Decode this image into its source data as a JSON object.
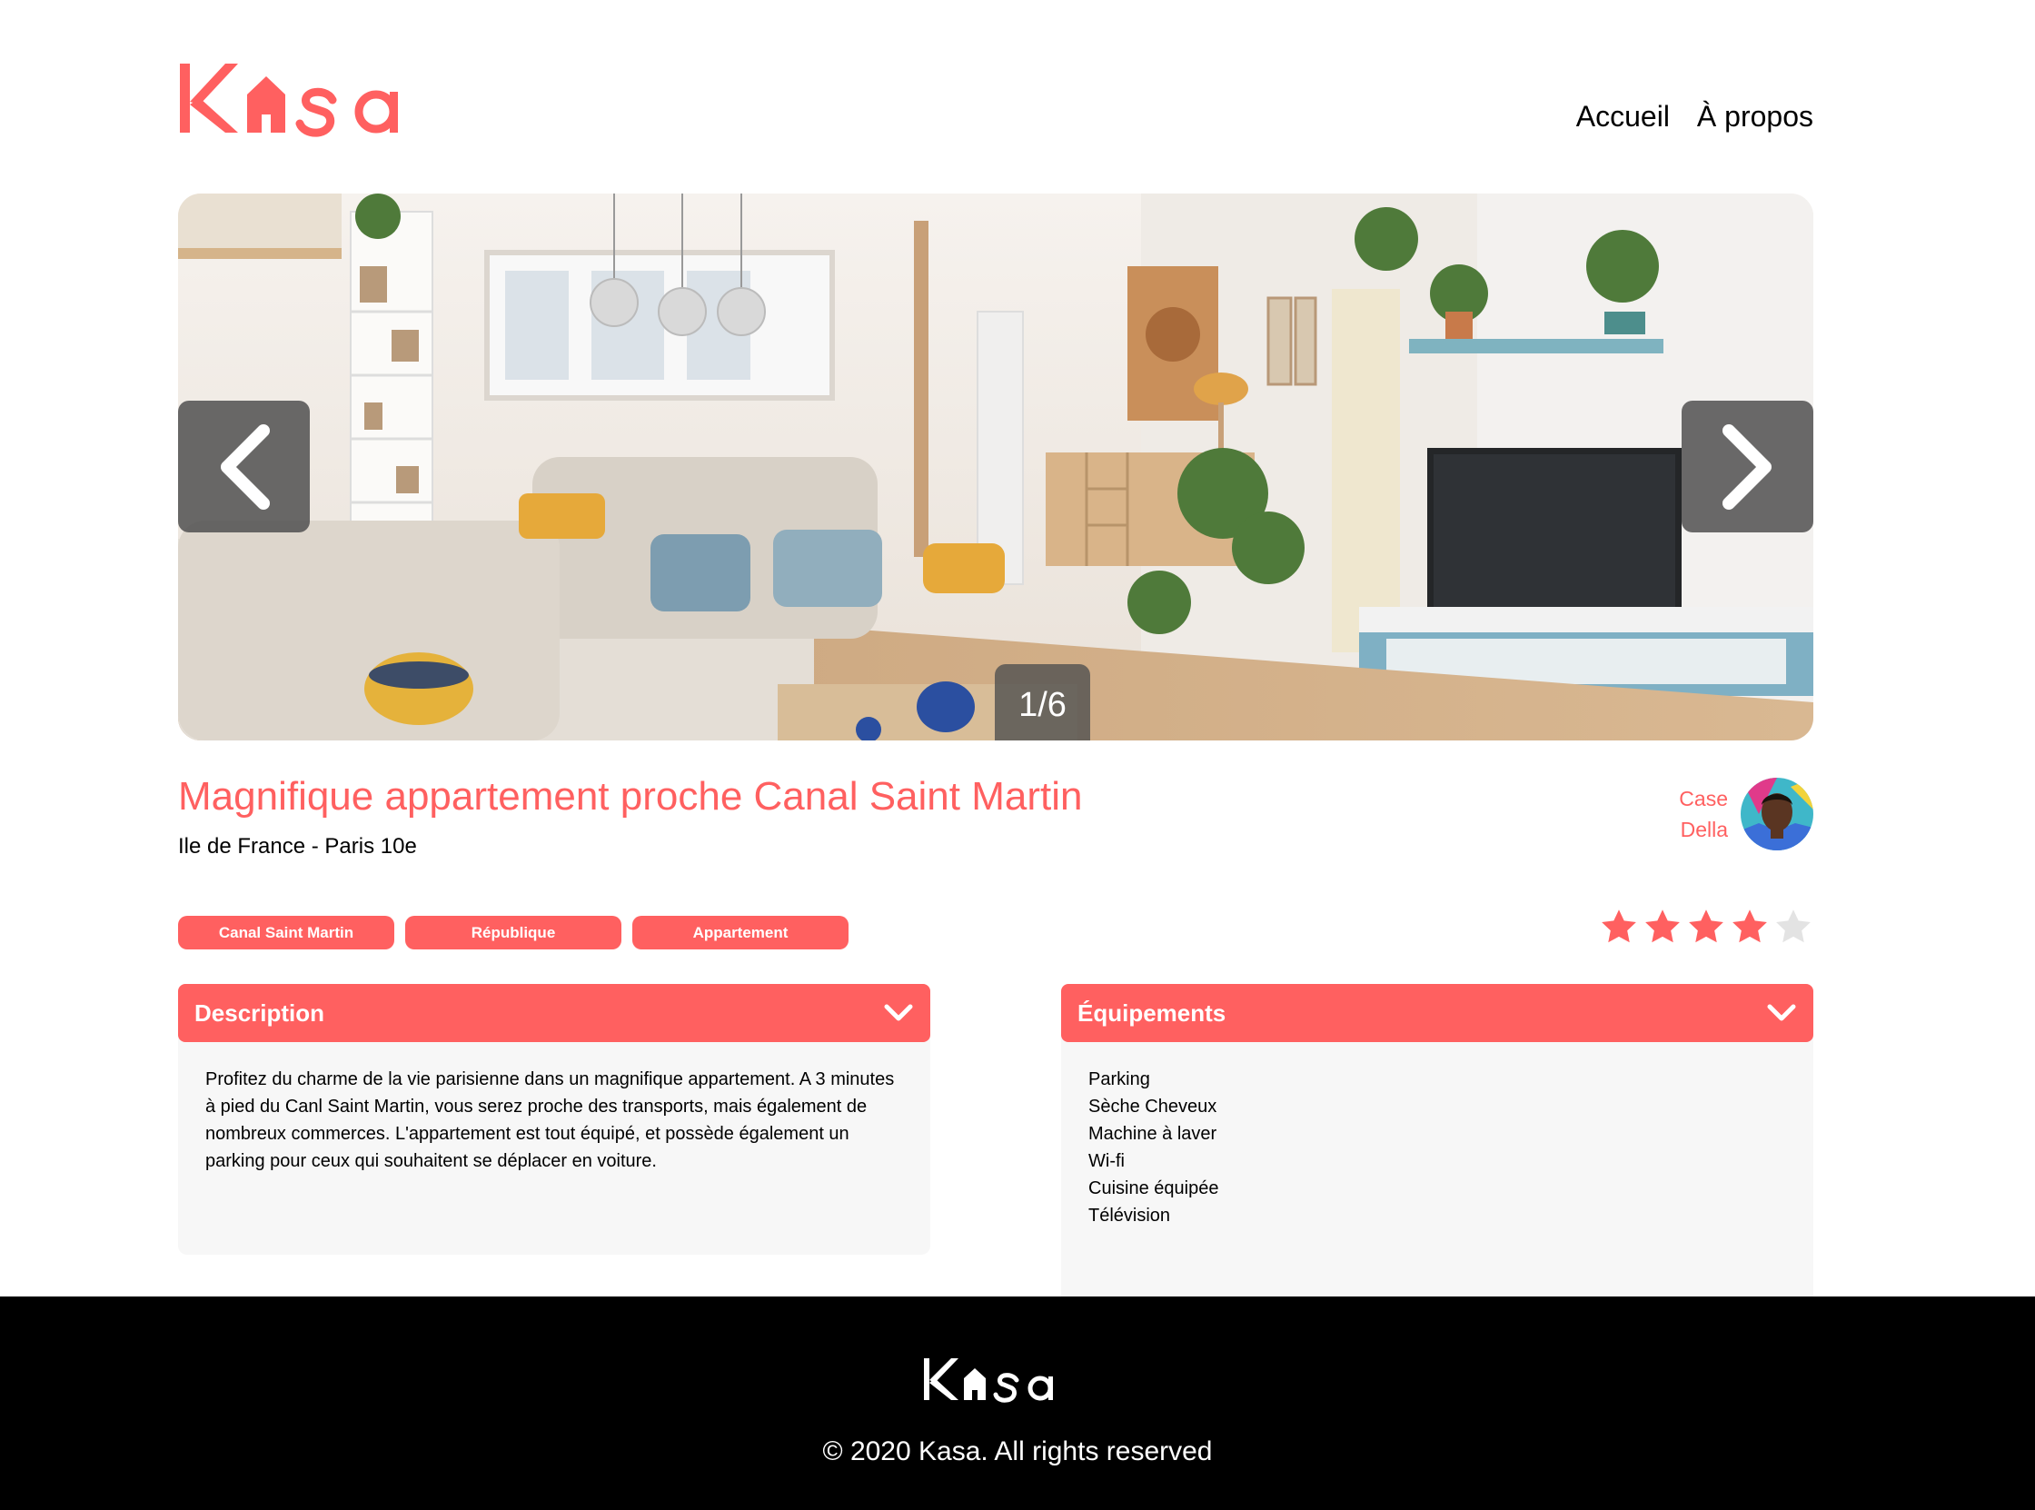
{
  "brand": {
    "name": "Kasa",
    "accent_color": "#FF6060"
  },
  "nav": {
    "home": "Accueil",
    "about": "À propos"
  },
  "carousel": {
    "counter": "1/6",
    "prev_icon": "chevron-left-icon",
    "next_icon": "chevron-right-icon"
  },
  "listing": {
    "title": "Magnifique appartement proche Canal Saint Martin",
    "location": "Ile de France - Paris 10e",
    "host": {
      "first_name": "Case",
      "last_name": "Della"
    },
    "tags": [
      "Canal Saint Martin",
      "République",
      "Appartement"
    ],
    "rating": 4,
    "rating_max": 5
  },
  "description": {
    "title": "Description",
    "text": "Profitez du charme de la vie parisienne dans un magnifique appartement. A 3 minutes à pied du Canl Saint Martin, vous serez proche des transports, mais également de nombreux commerces. L'appartement est tout équipé, et possède également un parking pour ceux qui souhaitent se déplacer en voiture."
  },
  "equipments": {
    "title": "Équipements",
    "items": [
      "Parking",
      "Sèche Cheveux",
      "Machine à laver",
      "Wi-fi",
      "Cuisine équipée",
      "Télévision"
    ]
  },
  "footer": {
    "copyright": "© 2020 Kasa. All rights reserved"
  }
}
